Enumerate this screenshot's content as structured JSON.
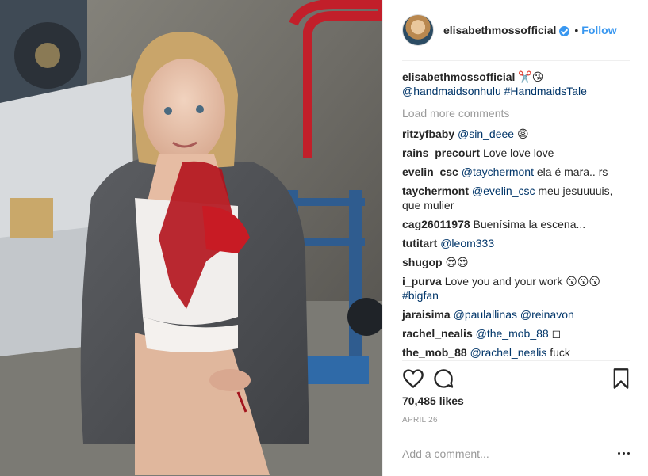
{
  "post": {
    "author": "elisabethmossofficial",
    "follow_label": "Follow",
    "separator": "•",
    "caption": {
      "username": "elisabethmossofficial",
      "emoji": "✂️😘",
      "mention": "@handmaidsonhulu",
      "hashtag": "#HandmaidsTale"
    },
    "load_more": "Load more comments",
    "comments": [
      {
        "user": "ritzyfbaby",
        "mention": "@sin_deee",
        "text": " 😩"
      },
      {
        "user": "rains_precourt",
        "mention": "",
        "text": "Love love love"
      },
      {
        "user": "evelin_csc",
        "mention": "@taychermont",
        "text": " ela é mara.. rs"
      },
      {
        "user": "taychermont",
        "mention": "@evelin_csc",
        "text": " meu jesuuuuis, que mulier"
      },
      {
        "user": "cag26011978",
        "mention": "",
        "text": "Buenísima la escena..."
      },
      {
        "user": "tutitart",
        "mention": "@leom333",
        "text": ""
      },
      {
        "user": "shugop",
        "mention": "",
        "text": "😍😍"
      },
      {
        "user": "i_purva",
        "mention": "",
        "text": "Love you and your work 😗😗😗 ",
        "tag": "#bigfan"
      },
      {
        "user": "jaraisima",
        "mention": "@paulallinas @reinavon",
        "text": ""
      },
      {
        "user": "rachel_nealis",
        "mention": "@the_mob_88",
        "text": " ◻"
      },
      {
        "user": "the_mob_88",
        "mention": "@rachel_nealis",
        "text": " fuck"
      }
    ],
    "likes": "70,485 likes",
    "date": "APRIL 26",
    "add_comment_placeholder": "Add a comment...",
    "icons": [
      "heart-icon",
      "comment-icon",
      "bookmark-icon",
      "more-options-icon",
      "verified-badge-icon"
    ],
    "colors": {
      "accent": "#3897f0",
      "mention": "#003569",
      "muted": "#999999",
      "text": "#262626"
    }
  }
}
